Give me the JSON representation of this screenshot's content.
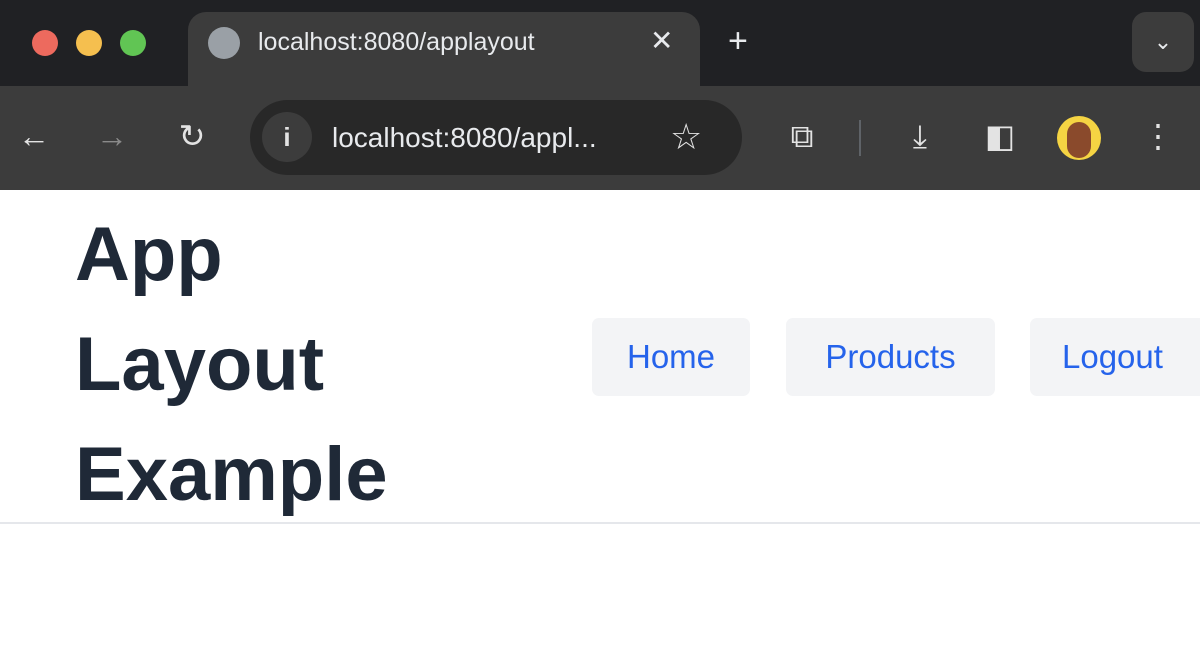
{
  "browser": {
    "tab_title": "localhost:8080/applayout",
    "address": "localhost:8080/appl...",
    "new_tab": "+",
    "close": "✕",
    "colors": {
      "close": "#ed6a5e",
      "minimize": "#f5bf4f",
      "maximize": "#61c554"
    }
  },
  "page": {
    "title": "App Layout Example",
    "nav": [
      {
        "label": "Home"
      },
      {
        "label": "Products"
      },
      {
        "label": "Logout"
      }
    ]
  }
}
